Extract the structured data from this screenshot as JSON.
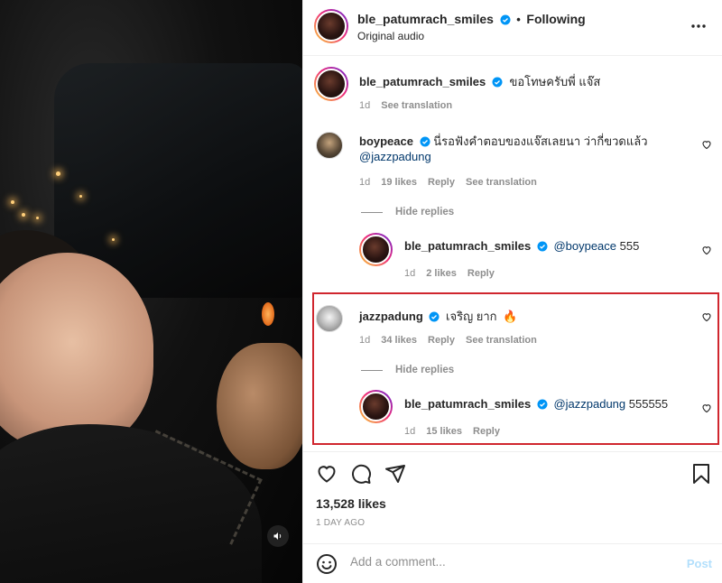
{
  "header": {
    "username": "ble_patumrach_smiles",
    "separator": "•",
    "follow_label": "Following",
    "audio": "Original audio",
    "more_icon": "more-horizontal-icon"
  },
  "caption": {
    "username": "ble_patumrach_smiles",
    "text": "ขอโทษครับพี่ แจ๊ส",
    "time": "1d",
    "see_translation": "See translation"
  },
  "comments": [
    {
      "username": "boypeace",
      "text_line1": "นี่รอฟังคำตอบของแจ๊สเลยนา ว่ากี่ขวดแล้ว",
      "mention": "@jazzpadung",
      "time": "1d",
      "likes": "19 likes",
      "reply": "Reply",
      "see_translation": "See translation",
      "hide_replies": "Hide replies",
      "reply_item": {
        "username": "ble_patumrach_smiles",
        "mention": "@boypeace",
        "text": "555",
        "time": "1d",
        "likes": "2 likes",
        "reply": "Reply"
      }
    },
    {
      "username": "jazzpadung",
      "text": "เจริญ ยาก",
      "emoji": "🔥",
      "time": "1d",
      "likes": "34 likes",
      "reply": "Reply",
      "see_translation": "See translation",
      "hide_replies": "Hide replies",
      "reply_item": {
        "username": "ble_patumrach_smiles",
        "mention": "@jazzpadung",
        "text": "555555",
        "time": "1d",
        "likes": "15 likes",
        "reply": "Reply"
      }
    }
  ],
  "stats": {
    "likes": "13,528 likes",
    "date": "1 DAY AGO"
  },
  "composer": {
    "placeholder": "Add a comment...",
    "post_label": "Post"
  },
  "colors": {
    "verified": "#0095f6",
    "highlight_border": "#d0262e",
    "post_disabled": "#b2dffc"
  }
}
